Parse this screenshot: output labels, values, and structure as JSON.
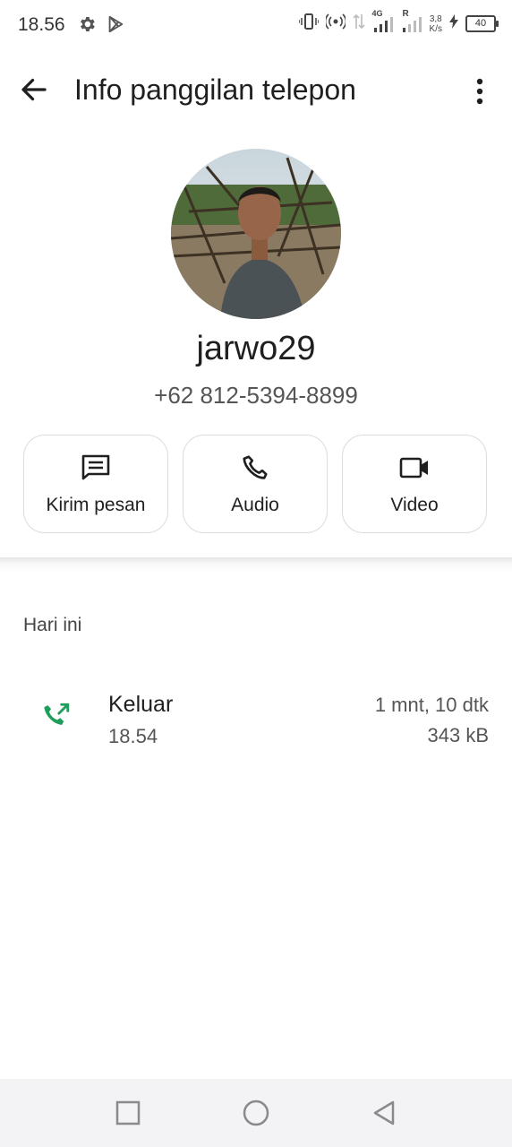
{
  "status_bar": {
    "time": "18.56",
    "network_type": "4G",
    "roaming": "R",
    "speed_value": "3,8",
    "speed_unit": "K/s",
    "battery": "40"
  },
  "app_bar": {
    "title": "Info panggilan telepon"
  },
  "contact": {
    "name": "jarwo29",
    "phone": "+62 812-5394-8899"
  },
  "actions": [
    {
      "label": "Kirim pesan",
      "icon": "message-icon"
    },
    {
      "label": "Audio",
      "icon": "phone-icon"
    },
    {
      "label": "Video",
      "icon": "video-icon"
    }
  ],
  "history": {
    "section_title": "Hari ini",
    "calls": [
      {
        "type": "Keluar",
        "time": "18.54",
        "duration": "1 mnt, 10 dtk",
        "size": "343 kB",
        "icon": "outgoing-call-icon",
        "icon_color": "#1e9e5a"
      }
    ]
  },
  "nav_bar": {
    "items": [
      "recents-button",
      "home-button",
      "back-button"
    ]
  }
}
